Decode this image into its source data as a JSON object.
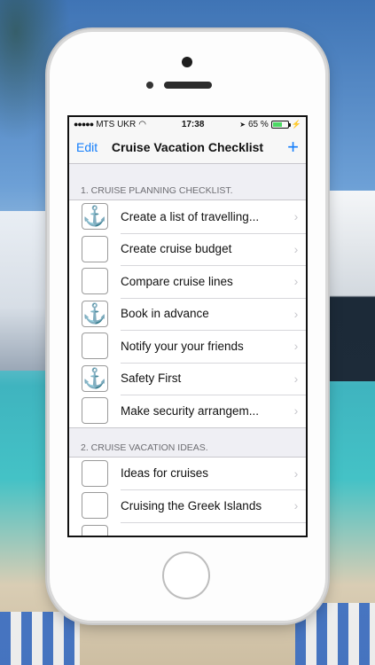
{
  "status": {
    "signal": "●●●●●",
    "carrier": "MTS UKR",
    "wifi_icon": "wifi-icon",
    "time": "17:38",
    "battery_pct": "65 %",
    "battery_level": 0.65
  },
  "nav": {
    "edit_label": "Edit",
    "title": "Cruise Vacation Checklist",
    "add_label": "+"
  },
  "sections": [
    {
      "header": "1. CRUISE PLANNING CHECKLIST.",
      "items": [
        {
          "label": "Create a list of travelling...",
          "checked": true
        },
        {
          "label": "Create cruise budget",
          "checked": false
        },
        {
          "label": "Compare cruise lines",
          "checked": false
        },
        {
          "label": "Book in advance",
          "checked": true
        },
        {
          "label": "Notify your your friends",
          "checked": false
        },
        {
          "label": "Safety First",
          "checked": true
        },
        {
          "label": "Make security arrangem...",
          "checked": false
        }
      ]
    },
    {
      "header": "2. CRUISE VACATION IDEAS.",
      "items": [
        {
          "label": "Ideas for cruises",
          "checked": false
        },
        {
          "label": "Cruising the Greek Islands",
          "checked": false
        },
        {
          "label": "",
          "checked": false
        }
      ]
    }
  ]
}
